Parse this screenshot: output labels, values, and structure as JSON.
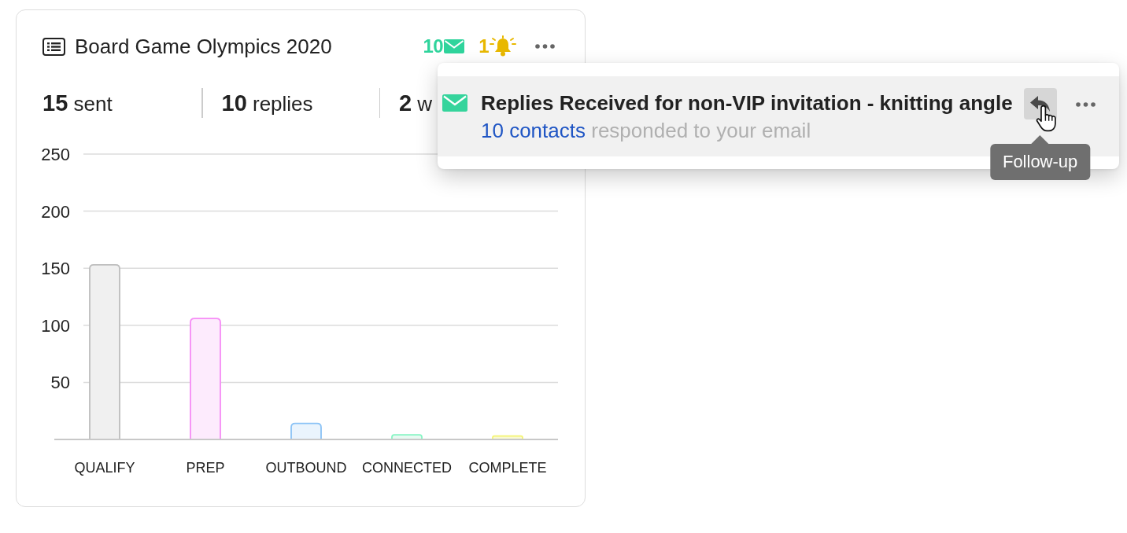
{
  "card": {
    "title": "Board Game Olympics 2020",
    "counters": [
      {
        "kind": "mail",
        "count": "10",
        "color": "#2fd49c"
      },
      {
        "kind": "bell",
        "count": "1",
        "color": "#e8b800"
      }
    ],
    "stats": [
      "**15** sent",
      "**10** replies",
      "**2** w"
    ],
    "chart_data": {
      "type": "bar",
      "categories": [
        "QUALIFY",
        "PREP",
        "OUTBOUND",
        "CONNECTED",
        "COMPLETE"
      ],
      "values": [
        153,
        106,
        14,
        4,
        3
      ],
      "colors": [
        "#f0f0f0",
        "#fdebfd",
        "#eaf4fd",
        "#e8faf2",
        "#fafad2"
      ],
      "ylim": [
        0,
        250
      ],
      "yticks": [
        50,
        100,
        150,
        200,
        250
      ],
      "grid": true
    }
  },
  "notification": {
    "title": "Replies Received for non-VIP invitation - knitting angle",
    "link": "10 contacts",
    "text": "responded to your email",
    "follow_up": {
      "hovered": true,
      "tooltip": "Follow-up"
    }
  }
}
